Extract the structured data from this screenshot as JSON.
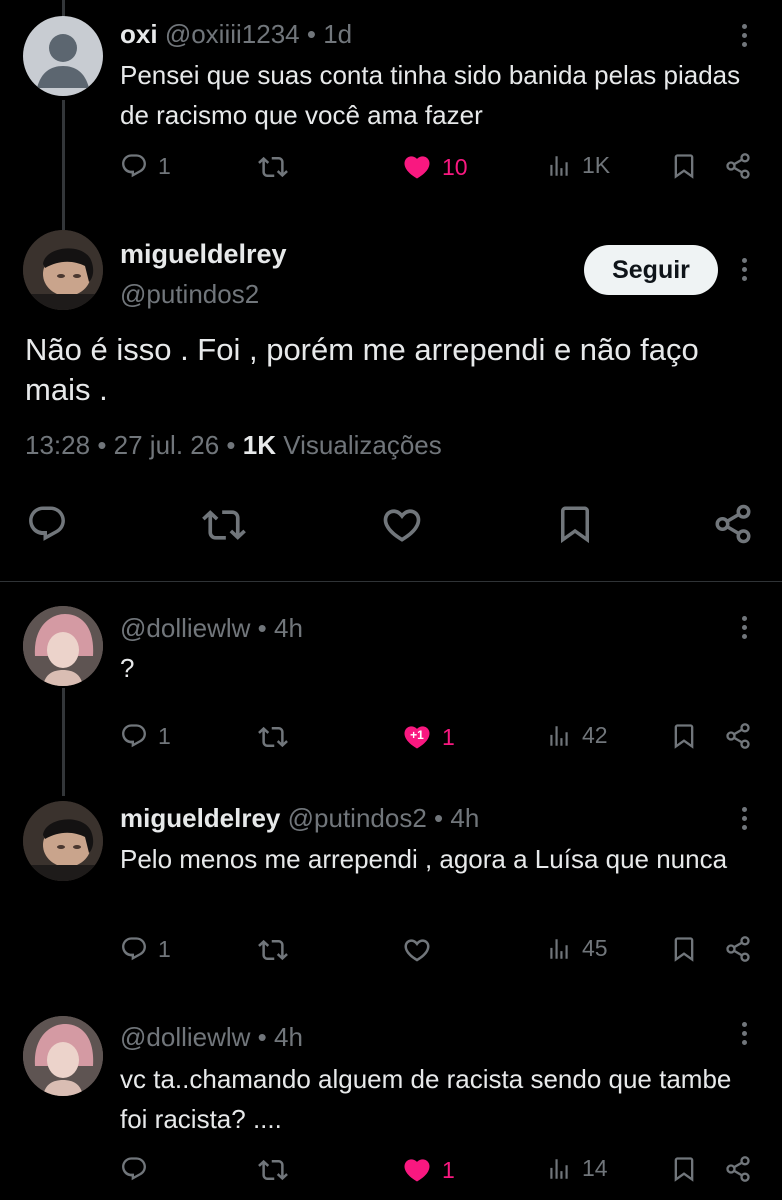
{
  "replies_to": {
    "name": "oxi",
    "handle": "@oxiiii1234",
    "sep": "•",
    "time": "1d",
    "text": "Pensei que suas conta tinha sido banida pelas piadas de racismo que você ama fazer",
    "replies": "1",
    "likes": "10",
    "views": "1K"
  },
  "main_post": {
    "name": "migueldelrey",
    "handle": "@putindos2",
    "follow_label": "Seguir",
    "text": "Não é isso . Foi , porém me arrependi e não faço mais .",
    "time": "13:28",
    "sep": "•",
    "date": "27 jul. 26",
    "views_count": "1K",
    "views_label": "Visualizações"
  },
  "replies": [
    {
      "name": "",
      "handle": "@dolliewlw",
      "sep": "•",
      "time": "4h",
      "text": "?",
      "replies": "1",
      "likes": "1",
      "like_badge": "+1",
      "views": "42"
    },
    {
      "name": "migueldelrey",
      "handle": "@putindos2",
      "sep": "•",
      "time": "4h",
      "text": "Pelo menos me arrependi , agora a Luísa que nunca",
      "replies": "1",
      "likes": "",
      "views": "45"
    },
    {
      "name": "",
      "handle": "@dolliewlw",
      "sep": "•",
      "time": "4h",
      "text": "vc ta..chamando alguem de racista sendo que tambe foi racista? ....",
      "replies": "",
      "likes": "1",
      "views": "14"
    }
  ],
  "colors": {
    "background": "#000000",
    "text": "#e7e9ea",
    "muted": "#71767b",
    "like": "#f91880",
    "divider": "#2f3336"
  }
}
